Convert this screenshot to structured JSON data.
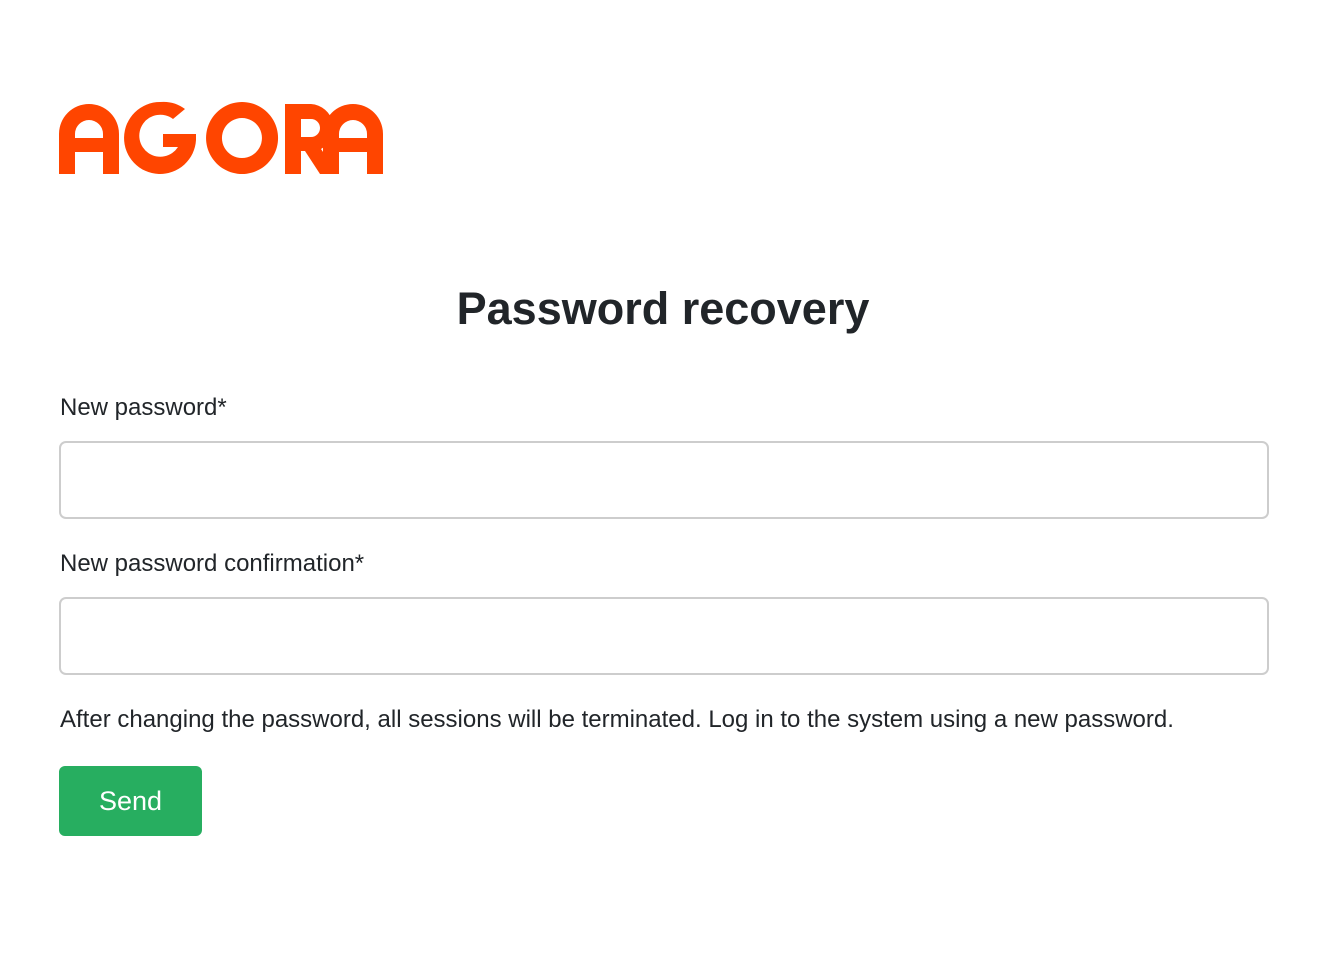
{
  "brand": {
    "logo_text": "AGORA",
    "color": "#ff4500"
  },
  "page": {
    "title": "Password recovery"
  },
  "form": {
    "new_password": {
      "label": "New password*",
      "value": "",
      "placeholder": ""
    },
    "new_password_confirmation": {
      "label": "New password confirmation*",
      "value": "",
      "placeholder": ""
    },
    "notice": "After changing the password, all sessions will be terminated. Log in to the system using a new password.",
    "submit_label": "Send"
  },
  "colors": {
    "accent": "#27ae60",
    "text": "#212529",
    "input_border": "#cdcdcd"
  }
}
